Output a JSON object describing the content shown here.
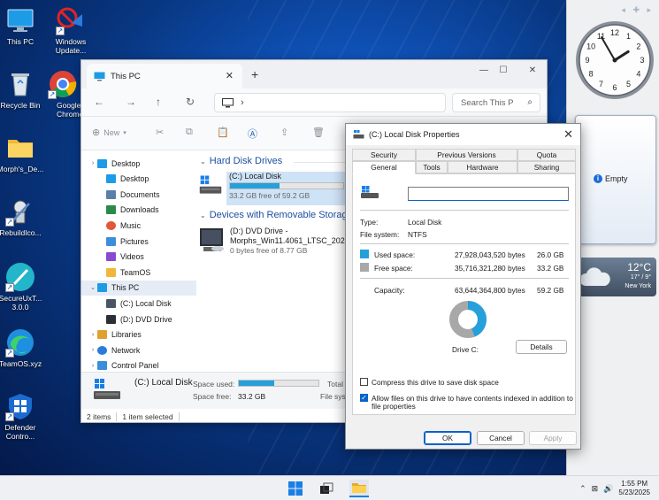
{
  "desktop": {
    "icons": [
      {
        "label": "This PC"
      },
      {
        "label": "Windows Update..."
      },
      {
        "label": "Recycle Bin"
      },
      {
        "label": "Google Chrome"
      },
      {
        "label": "Morph's_De..."
      },
      {
        "label": "RebuildIco..."
      },
      {
        "label": "SecureUxT... 3.0.0"
      },
      {
        "label": "TeamOS.xyz"
      },
      {
        "label": "Defender Contro..."
      }
    ]
  },
  "gadgets": {
    "notes_label": "Empty",
    "weather": {
      "temp": "12°C",
      "range": "17° / 9°",
      "city": "New York"
    },
    "clock": {
      "hour": 1,
      "minute": 55
    }
  },
  "taskbar": {
    "time": "1:55 PM",
    "date": "5/23/2025"
  },
  "explorer": {
    "tab_title": "This PC",
    "address_crumb": "›",
    "search_placeholder": "Search This P",
    "new_label": "New",
    "nav_items": [
      {
        "label": "Desktop",
        "icon": "desktop-icon"
      },
      {
        "label": "Desktop",
        "icon": "desktop-icon"
      },
      {
        "label": "Documents",
        "icon": "documents-icon"
      },
      {
        "label": "Downloads",
        "icon": "downloads-icon"
      },
      {
        "label": "Music",
        "icon": "music-icon"
      },
      {
        "label": "Pictures",
        "icon": "pictures-icon"
      },
      {
        "label": "Videos",
        "icon": "videos-icon"
      },
      {
        "label": "TeamOS",
        "icon": "folder-icon"
      },
      {
        "label": "This PC",
        "icon": "computer-icon"
      },
      {
        "label": "(C:) Local Disk",
        "icon": "drive-icon"
      },
      {
        "label": "(D:) DVD Drive",
        "icon": "dvd-icon"
      },
      {
        "label": "Libraries",
        "icon": "libraries-icon"
      },
      {
        "label": "Network",
        "icon": "network-icon"
      },
      {
        "label": "Control Panel",
        "icon": "control-panel-icon"
      }
    ],
    "group_hard_disks": "Hard Disk Drives",
    "group_removable": "Devices with Removable Storage",
    "drive_c": {
      "name": "(C:) Local Disk",
      "free_text": "33.2 GB free of 59.2 GB",
      "used_fraction": 0.44
    },
    "drive_d": {
      "name": "(D:) DVD Drive -",
      "name2": "Morphs_Win11.4061_LTSC_2024",
      "free_text": "0 bytes free of 8.77 GB"
    },
    "details": {
      "name": "(C:) Local Disk",
      "space_used_label": "Space used:",
      "space_free_label": "Space free:",
      "space_free_value": "33.2 GB",
      "total_label": "Total",
      "filesystem_label": "File sys",
      "used_fraction": 0.44
    },
    "status": {
      "items": "2 items",
      "selected": "1 item selected"
    }
  },
  "properties": {
    "title": "(C:) Local Disk Properties",
    "tabs_row1": [
      "Security",
      "Previous Versions",
      "Quota"
    ],
    "tabs_row2": [
      "General",
      "Tools",
      "Hardware",
      "Sharing"
    ],
    "active_tab": "General",
    "name_value": "",
    "type_label": "Type:",
    "type_value": "Local Disk",
    "fs_label": "File system:",
    "fs_value": "NTFS",
    "used_label": "Used space:",
    "used_bytes": "27,928,043,520 bytes",
    "used_gb": "26.0 GB",
    "free_label": "Free space:",
    "free_bytes": "35,716,321,280 bytes",
    "free_gb": "33.2 GB",
    "capacity_label": "Capacity:",
    "capacity_bytes": "63,644,364,800 bytes",
    "capacity_gb": "59.2 GB",
    "drive_label": "Drive C:",
    "details_button": "Details",
    "compress_label": "Compress this drive to save disk space",
    "compress_checked": false,
    "index_label_1": "Allow files on this drive to have contents indexed in addition to",
    "index_label_2": "file properties",
    "index_checked": true,
    "ok": "OK",
    "cancel": "Cancel",
    "apply": "Apply",
    "used_fraction": 0.439,
    "colors": {
      "used": "#26a0da",
      "free": "#a8a8a8"
    }
  }
}
